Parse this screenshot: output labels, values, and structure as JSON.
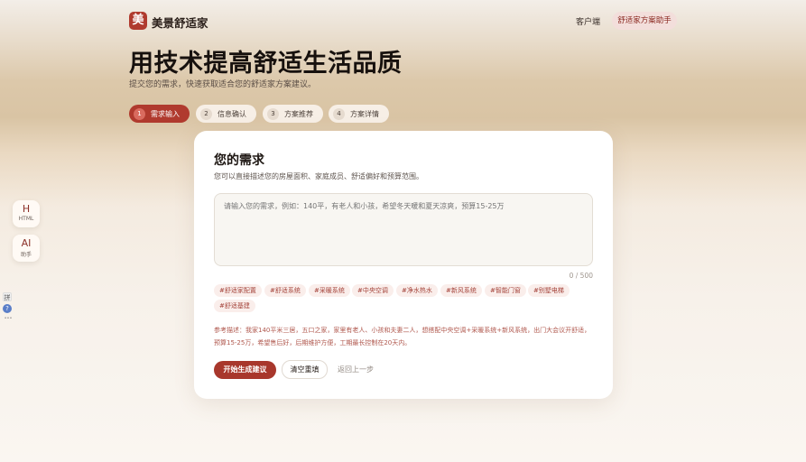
{
  "header": {
    "logo_char": "美",
    "brand": "美景舒适家",
    "nav_client": "客户端",
    "nav_assistant": "舒适家方案助手"
  },
  "hero": {
    "title": "用技术提高舒适生活品质",
    "subtitle": "提交您的需求，快速获取适合您的舒适家方案建议。"
  },
  "steps": [
    {
      "num": "1",
      "label": "需求输入",
      "active": true
    },
    {
      "num": "2",
      "label": "信息确认",
      "active": false
    },
    {
      "num": "3",
      "label": "方案推荐",
      "active": false
    },
    {
      "num": "4",
      "label": "方案详情",
      "active": false
    }
  ],
  "form": {
    "title": "您的需求",
    "subtitle": "您可以直接描述您的房屋面积、家庭成员、舒适偏好和预算范围。",
    "placeholder": "请输入您的需求，例如：140平，有老人和小孩，希望冬天暖和夏天凉爽，预算15-25万",
    "value": "",
    "counter": "0 / 500",
    "tags": [
      "#舒适家配置",
      "#舒适系统",
      "#采暖系统",
      "#中央空调",
      "#净水热水",
      "#新风系统",
      "#智能门窗",
      "#别墅电梯",
      "#舒适基建"
    ],
    "reference": "参考描述：我家140平米三居，五口之家，家里有老人、小孩和夫妻二人，想搭配中央空调+采暖系统+新风系统，出门大会议开舒适，预算15-25万，希望售后好，后期维护方便，工期最长控制在20天内。",
    "btn_generate": "开始生成建议",
    "btn_clear": "清空重填",
    "btn_back": "返回上一步"
  },
  "side_widgets": [
    {
      "big": "H",
      "small": "HTML"
    },
    {
      "big": "AI",
      "small": "助手"
    }
  ],
  "ime": {
    "glyph": "拼",
    "help": "?",
    "dots": "•••"
  },
  "colors": {
    "accent": "#b03a2e",
    "tag_text": "#a4433a",
    "tag_bg": "#faeeeb"
  }
}
